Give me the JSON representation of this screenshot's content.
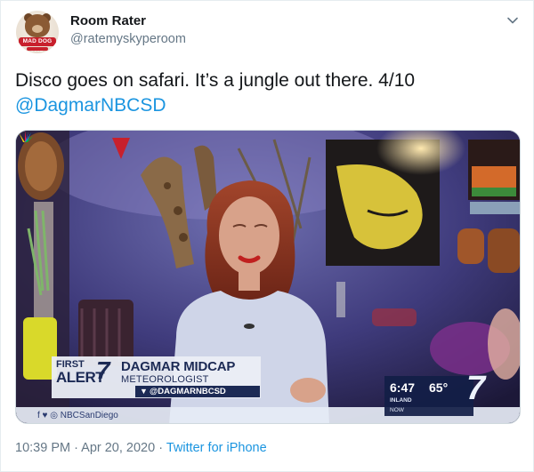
{
  "tweet": {
    "display_name": "Room Rater",
    "handle": "@ratemyskyperoom",
    "avatar_badge": "MAD DOG PAC",
    "text": "Disco goes on safari. It’s a jungle out there. 4/10",
    "mention": "@DagmarNBCSD",
    "timestamp": "10:39 PM · Apr 20, 2020",
    "separator": " · ",
    "source": "Twitter for iPhone"
  },
  "broadcast": {
    "lower_third": {
      "first": "FIRST",
      "alert": "ALERT",
      "seven": "7",
      "name": "DAGMAR MIDCAP",
      "title": "METEOROLOGIST",
      "twitter": "@DAGMARNBCSD"
    },
    "ticker": {
      "social": "NBCSanDiego",
      "social_icons": "f ♥ ◎"
    },
    "weather": {
      "time": "6:47",
      "temp": "65°",
      "region": "INLAND",
      "now": "NOW"
    },
    "station_logo": "7"
  },
  "icons": {
    "caret": "chevron-down-icon",
    "twitter_bird": "twitter-bird-icon",
    "peacock": "nbc-peacock-icon"
  },
  "colors": {
    "link": "#1b95e0",
    "secondary_text": "#657786",
    "news_navy": "#1c2a55"
  }
}
